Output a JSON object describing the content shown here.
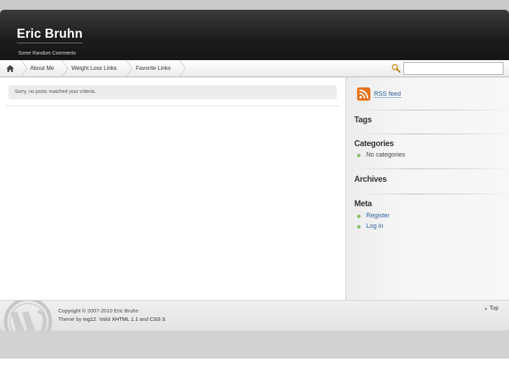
{
  "header": {
    "title": "Eric Bruhn",
    "tagline": "Some Random Comments"
  },
  "nav": {
    "home_icon": "home-icon",
    "items": [
      {
        "label": "About Me"
      },
      {
        "label": "Weight Loss Links"
      },
      {
        "label": "Favorite Links"
      }
    ],
    "search": {
      "icon": "search-icon",
      "value": ""
    }
  },
  "main": {
    "notice": "Sorry, no posts matched your criteria."
  },
  "sidebar": {
    "rss": {
      "icon": "rss-icon",
      "label": "RSS feed"
    },
    "tags": {
      "heading": "Tags"
    },
    "categories": {
      "heading": "Categories",
      "items": [
        "No categories"
      ]
    },
    "archives": {
      "heading": "Archives"
    },
    "meta": {
      "heading": "Meta",
      "items": [
        "Register",
        "Log in"
      ]
    }
  },
  "footer": {
    "copyright": "Copyright © 2007-2010 Eric Bruhn",
    "theme_prefix": "Theme by",
    "theme_author": "mg12",
    "valid_prefix": ". Valid",
    "xhtml": "XHTML 1.1",
    "and": "and",
    "css": "CSS 3",
    "period": ".",
    "top_label": "Top"
  },
  "colors": {
    "link": "#2b5c9a",
    "bullet": "#8cbf6a",
    "header_bg": "#1c1c1c",
    "rss_orange": "#e8721c"
  }
}
